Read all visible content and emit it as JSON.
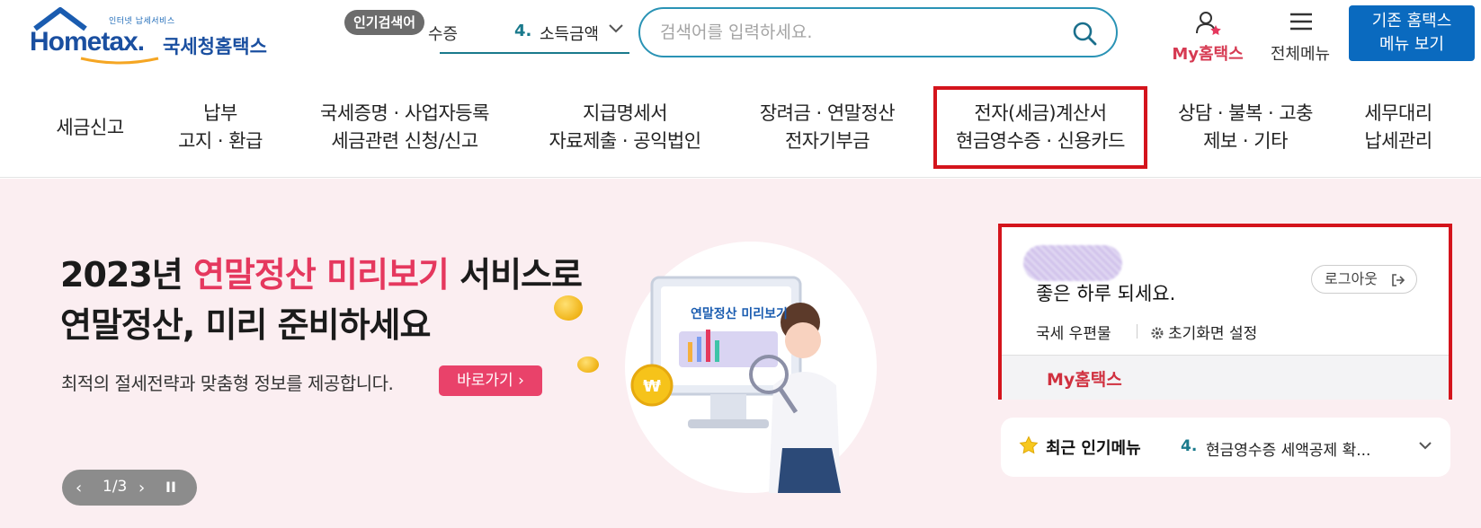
{
  "header": {
    "logo": {
      "sub": "인터넷 납세서비스",
      "main": "Hometax.",
      "ko": "국세청홈택스"
    },
    "popular": {
      "badge": "인기검색어",
      "prev_item": "수증",
      "rank": "4.",
      "item": "소득금액"
    },
    "search": {
      "placeholder": "검색어를 입력하세요."
    },
    "my_hometax": "My홈택스",
    "all_menu": "전체메뉴",
    "legacy_button": {
      "line1": "기존 홈택스",
      "line2": "메뉴 보기"
    }
  },
  "nav": [
    {
      "line1": "세금신고",
      "line2": ""
    },
    {
      "line1": "납부",
      "line2": "고지 · 환급"
    },
    {
      "line1": "국세증명 · 사업자등록",
      "line2": "세금관련 신청/신고"
    },
    {
      "line1": "지급명세서",
      "line2": "자료제출 · 공익법인"
    },
    {
      "line1": "장려금 · 연말정산",
      "line2": "전자기부금"
    },
    {
      "line1": "전자(세금)계산서",
      "line2": "현금영수증 · 신용카드"
    },
    {
      "line1": "상담 · 불복 · 고충",
      "line2": "제보 · 기타"
    },
    {
      "line1": "세무대리",
      "line2": "납세관리"
    }
  ],
  "banner": {
    "title_a": "2023년 ",
    "title_pink": "연말정산 미리보기",
    "title_b": " 서비스로",
    "title_line2": "연말정산, 미리 준비하세요",
    "subtitle": "최적의 절세전략과 맞춤형 정보를 제공합니다.",
    "go_button": "바로가기",
    "illustration_label": "연말정산 미리보기",
    "pager": "1/3"
  },
  "user_card": {
    "greeting": "좋은 하루 되세요.",
    "logout": "로그아웃",
    "mail": "국세 우편물",
    "settings": "초기화면 설정",
    "footer_link": "My홈택스"
  },
  "recent_menu": {
    "title": "최근 인기메뉴",
    "rank": "4.",
    "item": "현금영수증 세액공제 확..."
  },
  "colors": {
    "brand_blue": "#1a4fa0",
    "accent_teal": "#2a93b5",
    "pink": "#e5385e",
    "highlight_red": "#d4141c",
    "banner_bg": "#fbeef1"
  }
}
